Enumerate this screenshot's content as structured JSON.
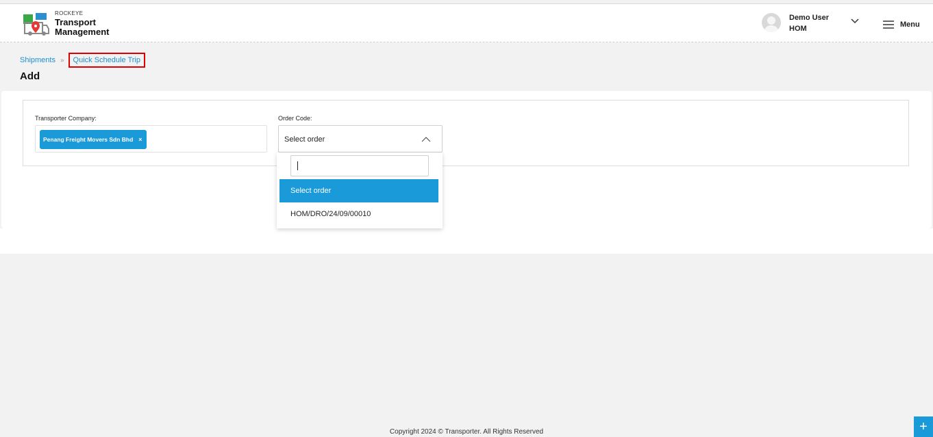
{
  "header": {
    "brand_small": "ROCKEYE",
    "brand_line1": "Transport",
    "brand_line2": "Management",
    "user_name": "Demo User",
    "user_branch": "HOM",
    "menu_label": "Menu"
  },
  "breadcrumb": {
    "parent": "Shipments",
    "current": "Quick Schedule Trip"
  },
  "page": {
    "title": "Add"
  },
  "form": {
    "transporter_label": "Transporter Company:",
    "transporter_selected": "Penang Freight Movers Sdn Bhd",
    "chip_remove": "×",
    "order_label": "Order Code:",
    "order_value": "Select order",
    "dropdown_search_value": "",
    "dropdown_options": [
      "Select order",
      "HOM/DRO/24/09/00010"
    ]
  },
  "footer": {
    "copyright": "Copyright 2024 © Transporter. All Rights Reserved"
  },
  "fab": {
    "label": "+"
  },
  "colors": {
    "accent": "#1a9ad9",
    "highlight_border": "#e00000",
    "background": "#f2f2f2"
  },
  "icons": [
    "logo-icon",
    "avatar-icon",
    "chevron-down-icon",
    "hamburger-icon",
    "chevron-up-icon",
    "double-chevron-right-icon",
    "plus-icon"
  ]
}
